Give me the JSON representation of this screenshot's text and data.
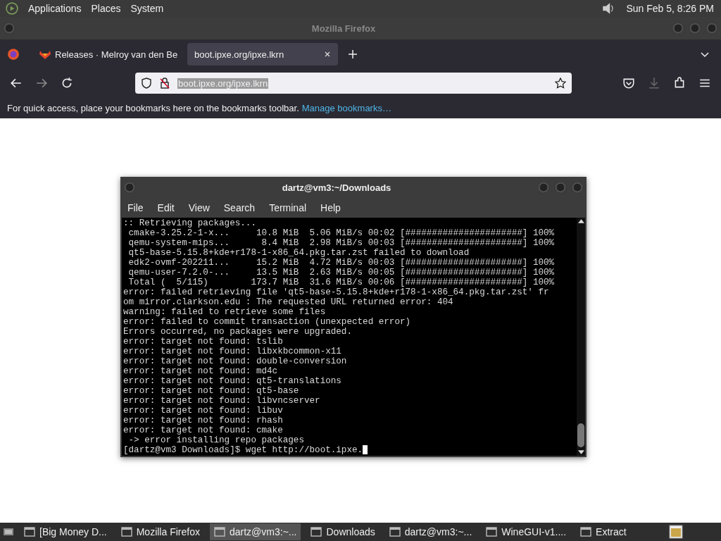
{
  "top_panel": {
    "menus": [
      "Applications",
      "Places",
      "System"
    ],
    "clock": "Sun Feb  5,  8:26 PM"
  },
  "window": {
    "title": "Mozilla Firefox"
  },
  "tabs": [
    {
      "label": "Releases · Melroy van den Be",
      "selected": false
    },
    {
      "label": "boot.ipxe.org/ipxe.lkrn",
      "selected": true
    }
  ],
  "address_bar": {
    "value": "boot.ipxe.org/ipxe.lkrn"
  },
  "bookmarks_bar": {
    "message": "For quick access, place your bookmarks here on the bookmarks toolbar.",
    "link": "Manage bookmarks…"
  },
  "terminal": {
    "title": "dartz@vm3:~/Downloads",
    "menus": [
      "File",
      "Edit",
      "View",
      "Search",
      "Terminal",
      "Help"
    ],
    "lines": [
      ":: Retrieving packages...",
      " cmake-3.25.2-1-x...     10.8 MiB  5.06 MiB/s 00:02 [######################] 100%",
      " qemu-system-mips...      8.4 MiB  2.98 MiB/s 00:03 [######################] 100%",
      " qt5-base-5.15.8+kde+r178-1-x86_64.pkg.tar.zst failed to download",
      " edk2-ovmf-202211...     15.2 MiB  4.72 MiB/s 00:03 [######################] 100%",
      " qemu-user-7.2.0-...     13.5 MiB  2.63 MiB/s 00:05 [######################] 100%",
      " Total (  5/115)        173.7 MiB  31.6 MiB/s 00:06 [######################] 100%",
      "error: failed retrieving file 'qt5-base-5.15.8+kde+r178-1-x86_64.pkg.tar.zst' fr",
      "om mirror.clarkson.edu : The requested URL returned error: 404",
      "warning: failed to retrieve some files",
      "error: failed to commit transaction (unexpected error)",
      "Errors occurred, no packages were upgraded.",
      "error: target not found: tslib",
      "error: target not found: libxkbcommon-x11",
      "error: target not found: double-conversion",
      "error: target not found: md4c",
      "error: target not found: qt5-translations",
      "error: target not found: qt5-base",
      "error: target not found: libvncserver",
      "error: target not found: libuv",
      "error: target not found: rhash",
      "error: target not found: cmake",
      " -> error installing repo packages",
      "[dartz@vm3 Downloads]$ wget http://boot.ipxe."
    ]
  },
  "taskbar": [
    {
      "label": "[Big Money D...",
      "selected": false
    },
    {
      "label": "Mozilla Firefox",
      "selected": false
    },
    {
      "label": "dartz@vm3:~...",
      "selected": true
    },
    {
      "label": "Downloads",
      "selected": false
    },
    {
      "label": "dartz@vm3:~...",
      "selected": false
    },
    {
      "label": "WineGUI-v1....",
      "selected": false
    },
    {
      "label": "Extract",
      "selected": false
    }
  ]
}
